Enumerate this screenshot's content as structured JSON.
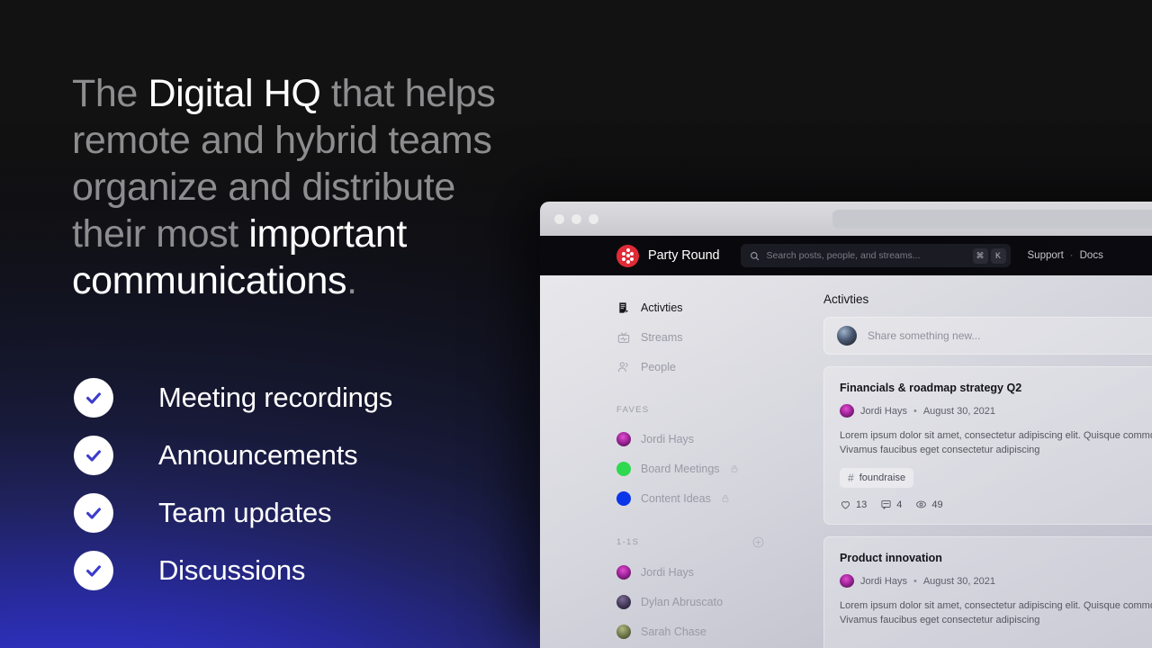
{
  "marketing": {
    "headline": {
      "part1": "The ",
      "highlight1": "Digital HQ",
      "part2": " that helps remote and hybrid teams organize and distribute their most ",
      "highlight2": "important communications",
      "period": "."
    },
    "features": [
      {
        "label": "Meeting recordings",
        "icon": "check-icon"
      },
      {
        "label": "Announcements",
        "icon": "check-icon"
      },
      {
        "label": "Team updates",
        "icon": "check-icon"
      },
      {
        "label": "Discussions",
        "icon": "check-icon"
      }
    ],
    "check_color": "#3b3ccc"
  },
  "app": {
    "brand": {
      "name": "Party Round",
      "logo_color": "#e02b37"
    },
    "search": {
      "placeholder": "Search posts, people, and streams...",
      "value": "",
      "shortcut_keys": [
        "⌘",
        "K"
      ]
    },
    "nav_links": [
      {
        "label": "Support"
      },
      {
        "label": "·"
      },
      {
        "label": "Docs"
      }
    ],
    "sidebar": {
      "items": [
        {
          "label": "Activties",
          "icon": "note-icon",
          "active": true
        },
        {
          "label": "Streams",
          "icon": "tv-icon",
          "active": false
        },
        {
          "label": "People",
          "icon": "people-icon",
          "active": false
        }
      ],
      "faves_header": "FAVES",
      "faves": [
        {
          "label": "Jordi Hays",
          "type": "avatar",
          "color": "#8e2a8e",
          "locked": false
        },
        {
          "label": "Board Meetings",
          "type": "swatch",
          "color": "#2fd94f",
          "locked": true
        },
        {
          "label": "Content Ideas",
          "type": "swatch",
          "color": "#0b35e8",
          "locked": true
        }
      ],
      "dms_header": "1-1S",
      "dms": [
        {
          "label": "Jordi Hays",
          "color": "#8e2a8e"
        },
        {
          "label": "Dylan Abruscato",
          "color": "#39304a"
        },
        {
          "label": "Sarah Chase",
          "color": "#6f7a4a"
        }
      ]
    },
    "feed": {
      "title": "Activties",
      "composer_placeholder": "Share something new...",
      "posts": [
        {
          "title": "Financials & roadmap strategy Q2",
          "author": "Jordi Hays",
          "separator": "•",
          "date": "August 30, 2021",
          "body": "Lorem ipsum dolor sit amet, consectetur adipiscing elit. Quisque commodo interdum felis nec ultrices. Vivamus faucibus eget consectetur adipiscing",
          "tag": "foundraise",
          "tag_glyph": "#",
          "stats": {
            "likes": "13",
            "comments": "4",
            "views": "49"
          }
        },
        {
          "title": "Product innovation",
          "author": "Jordi Hays",
          "separator": "•",
          "date": "August 30, 2021",
          "body": "Lorem ipsum dolor sit amet, consectetur adipiscing elit. Quisque commodo interdum felis nec ultrices. Vivamus faucibus eget consectetur adipiscing",
          "tag": "",
          "tag_glyph": "#",
          "stats": {
            "likes": "",
            "comments": "",
            "views": ""
          }
        }
      ]
    }
  }
}
